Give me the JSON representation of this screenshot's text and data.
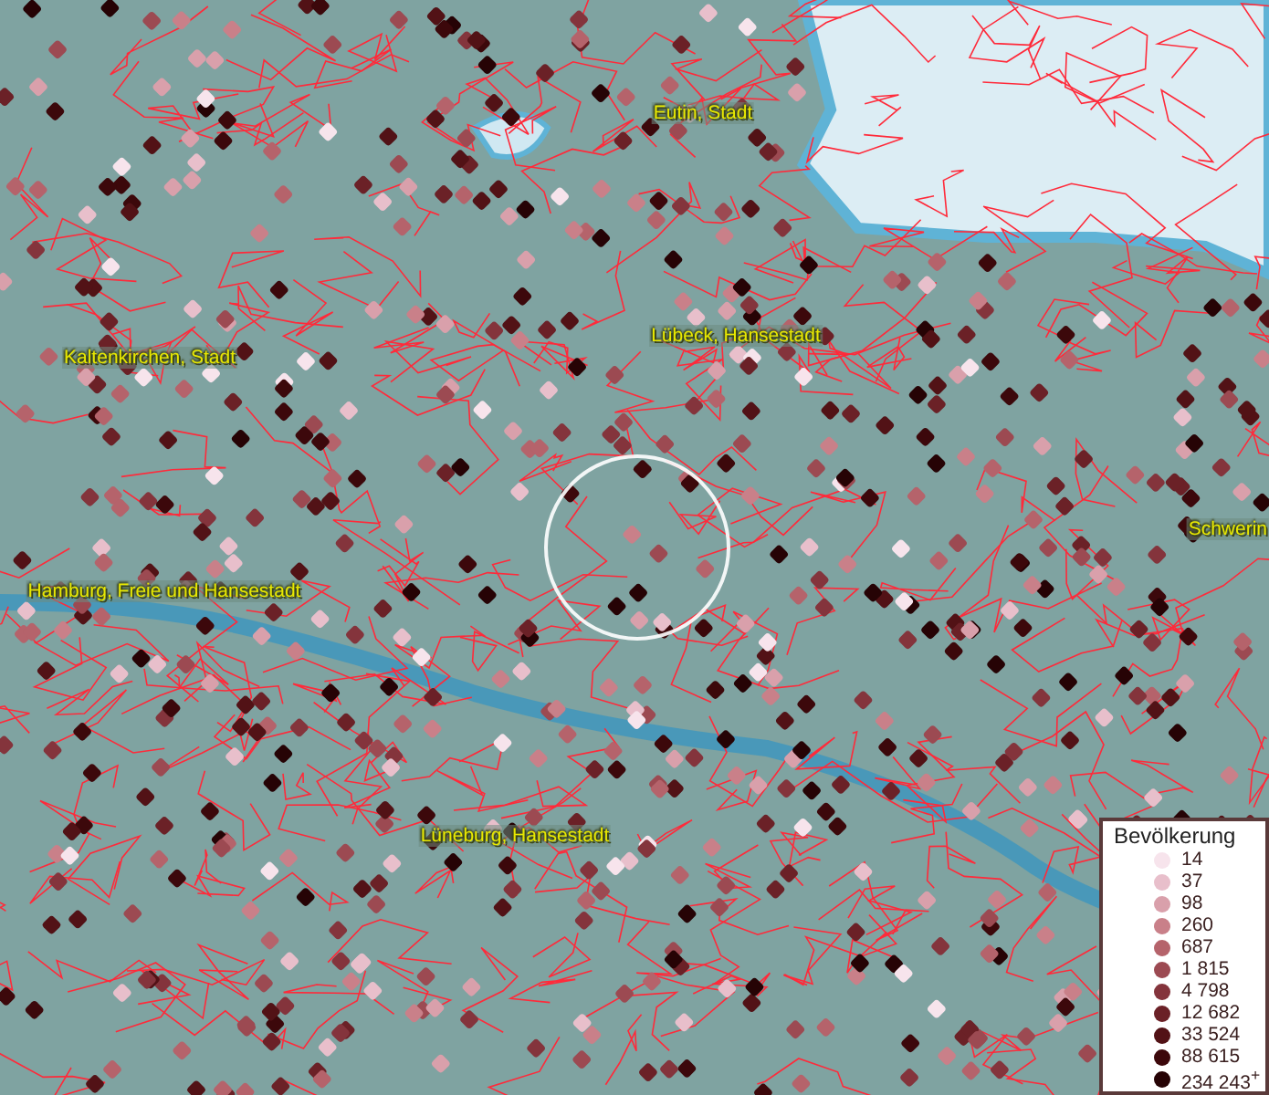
{
  "map": {
    "labels": [
      {
        "text": "Eutin, Stadt"
      },
      {
        "text": "Kaltenkirchen, Stadt"
      },
      {
        "text": "Lübeck, Hansestadt"
      },
      {
        "text": "Schwerin"
      },
      {
        "text": "Hamburg, Freie und Hansestadt"
      },
      {
        "text": "Lüneburg, Hansestadt"
      }
    ]
  },
  "legend": {
    "title": "Bevölkerung",
    "items": [
      {
        "label": "14",
        "color": "#f7e4ec"
      },
      {
        "label": "37",
        "color": "#e8bfcb"
      },
      {
        "label": "98",
        "color": "#d9a0ab"
      },
      {
        "label": "260",
        "color": "#c98089"
      },
      {
        "label": "687",
        "color": "#b5636b"
      },
      {
        "label": "1 815",
        "color": "#9c4a52"
      },
      {
        "label": "4 798",
        "color": "#84343c"
      },
      {
        "label": "12 682",
        "color": "#6b2127"
      },
      {
        "label": "33 524",
        "color": "#521216"
      },
      {
        "label": "88 615",
        "color": "#3c080b"
      },
      {
        "label": "234 243$^{+}$",
        "color": "#260305"
      }
    ]
  }
}
